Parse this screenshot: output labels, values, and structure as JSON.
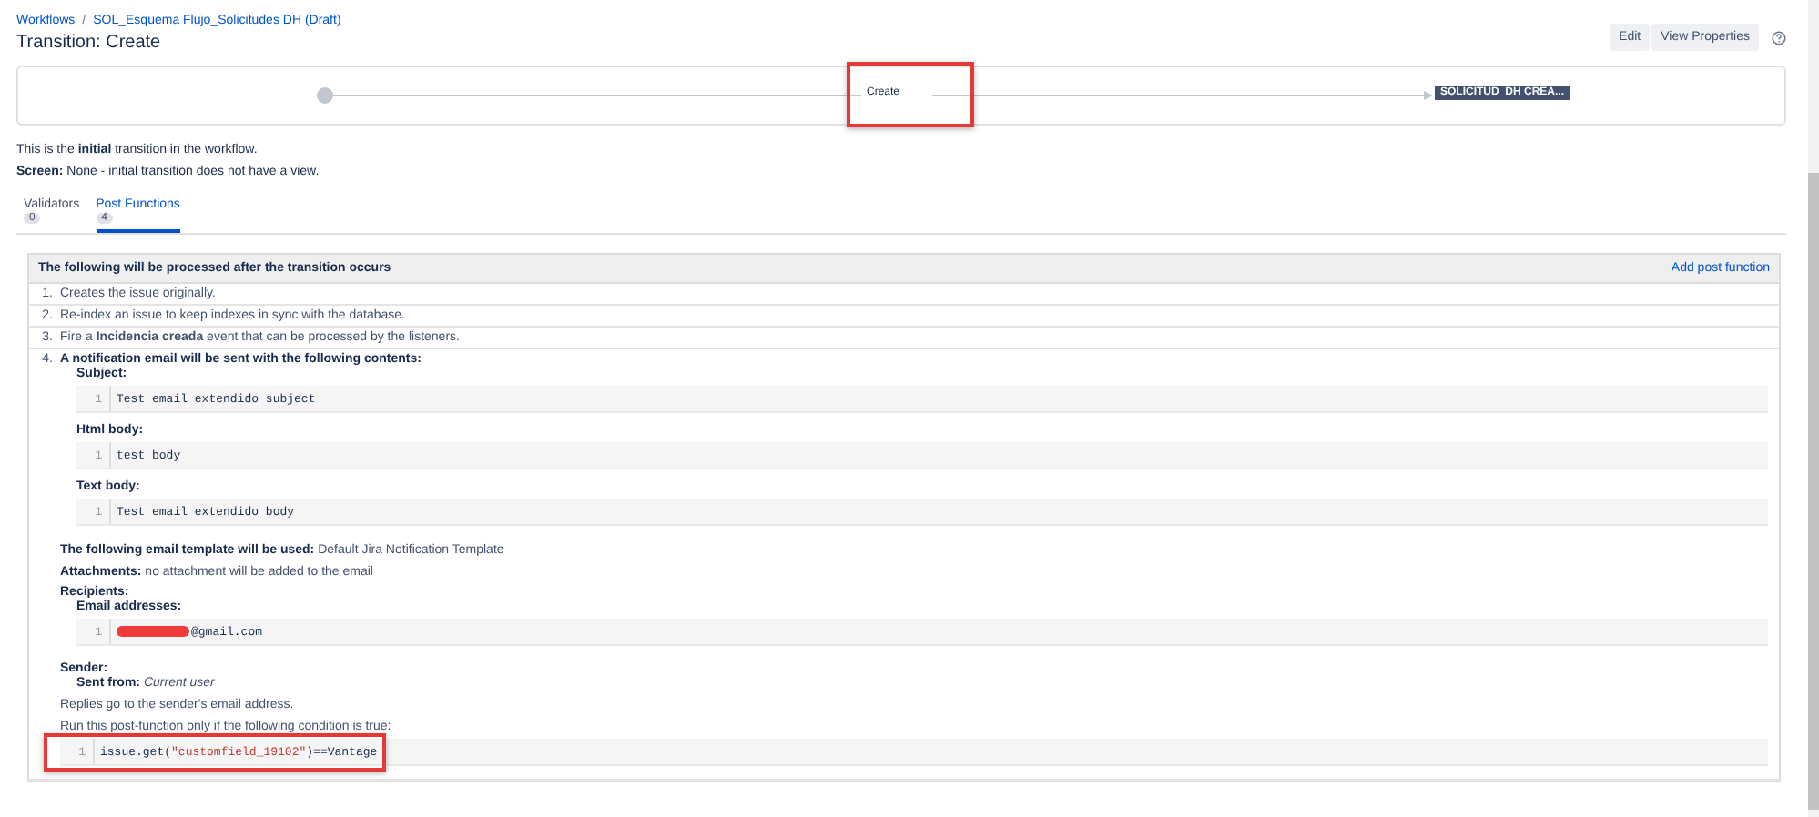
{
  "breadcrumbs": [
    {
      "label": "Workflows"
    },
    {
      "label": "SOL_Esquema Flujo_Solicitudes DH (Draft)"
    }
  ],
  "breadcrumb_separator": "/",
  "title": "Transition: Create",
  "actions": [
    "Edit",
    "View Properties"
  ],
  "diagram": {
    "transition": "Create",
    "target_status": "SOLICITUD_DH CREA...",
    "highlighted": true
  },
  "info": "This is the **initial** transition in the workflow.",
  "screen": "**Screen:** None - initial transition does not have a view.",
  "tabs": [
    {
      "label": "Validators",
      "count": "0",
      "selected": false
    },
    {
      "label": "Post Functions",
      "count": "4",
      "selected": true
    }
  ],
  "post_functions": {
    "header": "The following will be processed after the transition occurs",
    "add_link": "Add post function",
    "items": [
      {
        "number": "1.",
        "text": "Creates the issue originally."
      },
      {
        "number": "2.",
        "text": "Re-index an issue to keep indexes in sync with the database."
      },
      {
        "number": "3.",
        "text": "Fire a **Incidencia creada** event that can be processed by the listeners."
      },
      {
        "number": "4.",
        "text": "**A notification email will be sent with the following contents:**",
        "blocks": [
          {
            "kind": "subheading",
            "text": "Subject:"
          },
          {
            "kind": "code",
            "line": "1",
            "tokens": [
              {
                "kind": "plain",
                "text": "Test email extendido subject"
              }
            ]
          },
          {
            "kind": "subheading",
            "text": "Html body:"
          },
          {
            "kind": "code",
            "line": "1",
            "tokens": [
              {
                "kind": "plain",
                "text": "test body"
              }
            ]
          },
          {
            "kind": "subheading",
            "text": "Text body:"
          },
          {
            "kind": "code",
            "line": "1",
            "tokens": [
              {
                "kind": "plain",
                "text": "Test email extendido body"
              }
            ]
          },
          {
            "kind": "text",
            "text": "**The following email template will be used:** Default Jira Notification Template"
          },
          {
            "kind": "text",
            "text": "**Attachments:** no attachment will be added to the email"
          },
          {
            "kind": "heading",
            "text": "Recipients:"
          },
          {
            "kind": "subheading",
            "text": "Email addresses:"
          },
          {
            "kind": "code",
            "line": "1",
            "tokens": [
              {
                "kind": "redaction"
              },
              {
                "kind": "plain",
                "text": "@gmail.com"
              }
            ]
          },
          {
            "kind": "heading",
            "text": "Sender:"
          },
          {
            "kind": "subtext",
            "text": "**Sent from:** *Current user*"
          },
          {
            "kind": "text",
            "text": "Replies go to the sender's email address."
          },
          {
            "kind": "text",
            "text": "Run this post-function only if the following condition is true:"
          },
          {
            "kind": "condition",
            "line": "1",
            "highlighted": true,
            "tokens": [
              {
                "kind": "plain",
                "text": "issue.get("
              },
              {
                "kind": "string",
                "text": "\"customfield_19102\""
              },
              {
                "kind": "plain",
                "text": ")==Vantage"
              }
            ]
          }
        ]
      }
    ]
  }
}
